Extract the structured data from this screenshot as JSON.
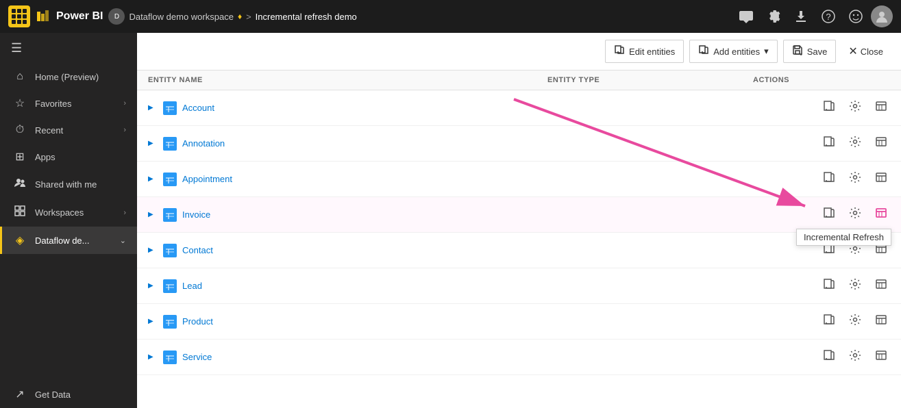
{
  "app": {
    "name": "Power BI"
  },
  "topbar": {
    "logo_label": "Power BI",
    "breadcrumb_workspace": "Dataflow demo workspace",
    "breadcrumb_sep": ">",
    "breadcrumb_current": "Incremental refresh demo",
    "avatar_initials": "D"
  },
  "sidebar": {
    "collapse_icon": "☰",
    "items": [
      {
        "id": "home",
        "label": "Home (Preview)",
        "icon": "⌂",
        "chevron": false,
        "active": false
      },
      {
        "id": "favorites",
        "label": "Favorites",
        "icon": "☆",
        "chevron": true,
        "active": false
      },
      {
        "id": "recent",
        "label": "Recent",
        "icon": "⏱",
        "chevron": true,
        "active": false
      },
      {
        "id": "apps",
        "label": "Apps",
        "icon": "⊞",
        "chevron": false,
        "active": false
      },
      {
        "id": "shared",
        "label": "Shared with me",
        "icon": "👤",
        "chevron": false,
        "active": false
      },
      {
        "id": "workspaces",
        "label": "Workspaces",
        "icon": "⊡",
        "chevron": true,
        "active": false
      },
      {
        "id": "dataflow",
        "label": "Dataflow de...",
        "icon": "◈",
        "chevron": true,
        "active": true
      }
    ],
    "bottom_items": [
      {
        "id": "get-data",
        "label": "Get Data",
        "icon": "↗",
        "active": false
      }
    ]
  },
  "toolbar": {
    "edit_entities_label": "Edit entities",
    "add_entities_label": "Add entities",
    "add_entities_icon": "▾",
    "save_label": "Save",
    "close_label": "Close"
  },
  "table": {
    "columns": [
      {
        "id": "entity-name",
        "label": "ENTITY NAME"
      },
      {
        "id": "entity-type",
        "label": "ENTITY TYPE"
      },
      {
        "id": "actions",
        "label": "ACTIONS"
      }
    ],
    "rows": [
      {
        "id": "account",
        "name": "Account",
        "type": "",
        "highlighted": false
      },
      {
        "id": "annotation",
        "name": "Annotation",
        "type": "",
        "highlighted": false
      },
      {
        "id": "appointment",
        "name": "Appointment",
        "type": "",
        "highlighted": false
      },
      {
        "id": "invoice",
        "name": "Invoice",
        "type": "",
        "highlighted": true
      },
      {
        "id": "contact",
        "name": "Contact",
        "type": "",
        "highlighted": false
      },
      {
        "id": "lead",
        "name": "Lead",
        "type": "",
        "highlighted": false
      },
      {
        "id": "product",
        "name": "Product",
        "type": "",
        "highlighted": false
      },
      {
        "id": "service",
        "name": "Service",
        "type": "",
        "highlighted": false
      }
    ]
  },
  "tooltip": {
    "label": "Incremental Refresh"
  },
  "colors": {
    "accent": "#f5c518",
    "link": "#0078d4",
    "arrow": "#e84a9e",
    "sidebar_bg": "#252424",
    "topbar_bg": "#1c1c1c"
  }
}
